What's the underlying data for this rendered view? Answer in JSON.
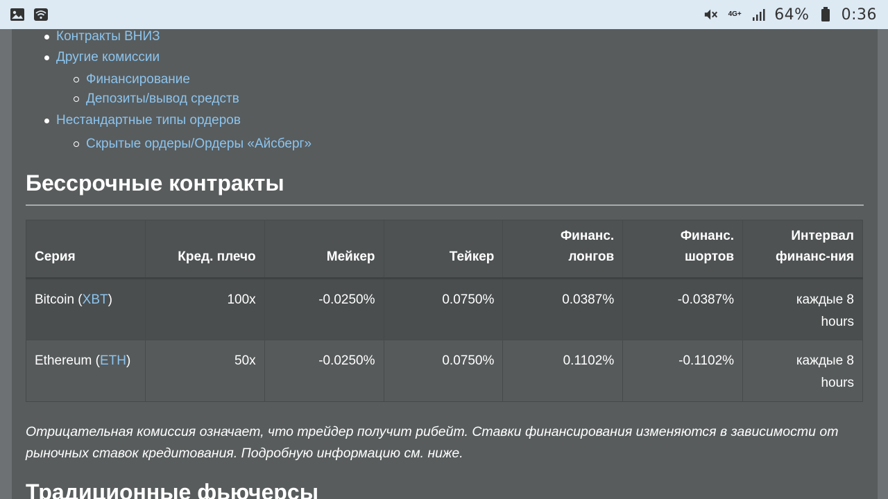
{
  "status_bar": {
    "battery_percent": "64%",
    "time": "0:36",
    "network": "4G+",
    "icons": [
      "image-icon",
      "wifi-icon",
      "mute-icon",
      "signal-icon",
      "battery-icon"
    ]
  },
  "toc": {
    "items": [
      {
        "label": "Контракты ВНИЗ"
      },
      {
        "label": "Другие комиссии"
      },
      {
        "label": "Финансирование"
      },
      {
        "label": "Депозиты/вывод средств"
      },
      {
        "label": "Нестандартные типы ордеров"
      },
      {
        "label": "Скрытые ордеры/Ордеры «Айсберг»"
      }
    ]
  },
  "section": {
    "title": "Бессрочные контракты",
    "next_title": "Традиционные фьючерсы"
  },
  "table": {
    "headers": [
      "Серия",
      "Кред. плечо",
      "Мейкер",
      "Тейкер",
      "Финанс.",
      "лонгов",
      "Финанс.",
      "шортов",
      "Интервал",
      "финанс-ния"
    ],
    "rows": [
      {
        "series_name": "Bitcoin (",
        "series_symbol": "XBT",
        "series_close": ")",
        "leverage": "100x",
        "maker": "-0.0250%",
        "taker": "0.0750%",
        "funding_long": "0.0387%",
        "funding_short": "-0.0387%",
        "interval_1": "каждые 8",
        "interval_2": "hours"
      },
      {
        "series_name": "Ethereum (",
        "series_symbol": "ETH",
        "series_close": ")",
        "leverage": "50x",
        "maker": "-0.0250%",
        "taker": "0.0750%",
        "funding_long": "0.1102%",
        "funding_short": "-0.1102%",
        "interval_1": "каждые 8",
        "interval_2": "hours"
      }
    ]
  },
  "note": "Отрицательная комиссия означает, что трейдер получит рибейт. Ставки финансирования изменяются в зависимости от рыночных ставок кредитования. Подробную информацию см. ниже."
}
